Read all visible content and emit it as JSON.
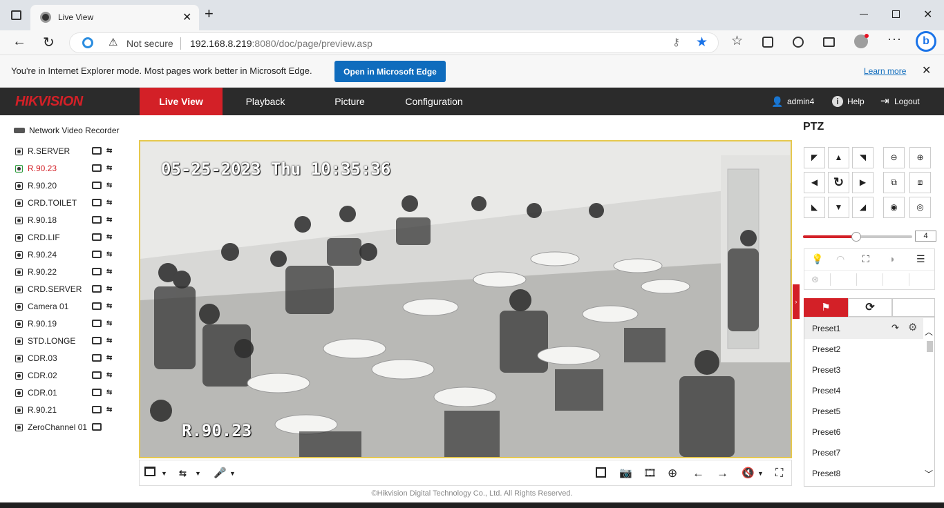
{
  "browser": {
    "tab_title": "Live View",
    "url_security": "Not secure",
    "url_host": "192.168.8.219",
    "url_rest": ":8080/doc/page/preview.asp",
    "ie_message": "You're in Internet Explorer mode. Most pages work better in Microsoft Edge.",
    "open_edge_label": "Open in Microsoft Edge",
    "learn_more": "Learn more"
  },
  "app": {
    "logo": "HIKVISION",
    "nav": [
      "Live View",
      "Playback",
      "Picture",
      "Configuration"
    ],
    "active_nav": "Live View",
    "user": "admin4",
    "help": "Help",
    "logout": "Logout",
    "accent": "#d32027"
  },
  "devices": {
    "root": "Network Video Recorder",
    "cameras": [
      {
        "label": "R.SERVER"
      },
      {
        "label": "R.90.23",
        "active": true
      },
      {
        "label": "R.90.20"
      },
      {
        "label": "CRD.TOILET"
      },
      {
        "label": "R.90.18"
      },
      {
        "label": "CRD.LIF"
      },
      {
        "label": "R.90.24"
      },
      {
        "label": "R.90.22"
      },
      {
        "label": "CRD.SERVER"
      },
      {
        "label": "Camera 01"
      },
      {
        "label": "R.90.19"
      },
      {
        "label": "STD.LONGE"
      },
      {
        "label": "CDR.03"
      },
      {
        "label": "CDR.02"
      },
      {
        "label": "CDR.01"
      },
      {
        "label": "R.90.21"
      },
      {
        "label": "ZeroChannel 01"
      }
    ]
  },
  "video": {
    "osd_datetime": "05-25-2023 Thu 10:35:36",
    "osd_channel": "R.90.23"
  },
  "ptz": {
    "title": "PTZ",
    "speed": "4",
    "speed_fraction": 0.49,
    "presets": [
      "Preset1",
      "Preset2",
      "Preset3",
      "Preset4",
      "Preset5",
      "Preset6",
      "Preset7",
      "Preset8"
    ]
  },
  "footer": "©Hikvision Digital Technology Co., Ltd. All Rights Reserved."
}
